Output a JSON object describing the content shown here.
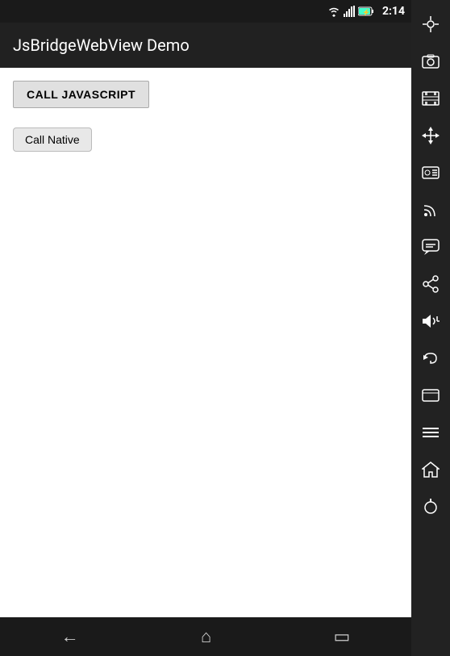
{
  "statusBar": {
    "time": "2:14",
    "icons": [
      "wifi",
      "signal",
      "battery",
      "battery-small"
    ]
  },
  "appBar": {
    "title": "JsBridgeWebView Demo"
  },
  "buttons": {
    "callJavascript": "CALL JAVASCRIPT",
    "callNative": "Call Native"
  },
  "navBar": {
    "back": "←",
    "home": "⌂",
    "recent": "▭"
  },
  "sidebar": {
    "icons": [
      {
        "name": "gps-icon",
        "symbol": "⊕"
      },
      {
        "name": "camera-icon",
        "symbol": "◉"
      },
      {
        "name": "film-icon",
        "symbol": "▤"
      },
      {
        "name": "move-icon",
        "symbol": "✛"
      },
      {
        "name": "id-icon",
        "symbol": "ID"
      },
      {
        "name": "rss-icon",
        "symbol": "◌"
      },
      {
        "name": "chat-icon",
        "symbol": "▭"
      },
      {
        "name": "share-icon",
        "symbol": "⋈"
      },
      {
        "name": "volume-icon",
        "symbol": "◁+"
      },
      {
        "name": "back-icon",
        "symbol": "↩"
      },
      {
        "name": "window-icon",
        "symbol": "▭"
      },
      {
        "name": "menu-icon",
        "symbol": "☰"
      },
      {
        "name": "home-icon",
        "symbol": "⌂"
      },
      {
        "name": "power-icon",
        "symbol": "⏻"
      }
    ]
  }
}
